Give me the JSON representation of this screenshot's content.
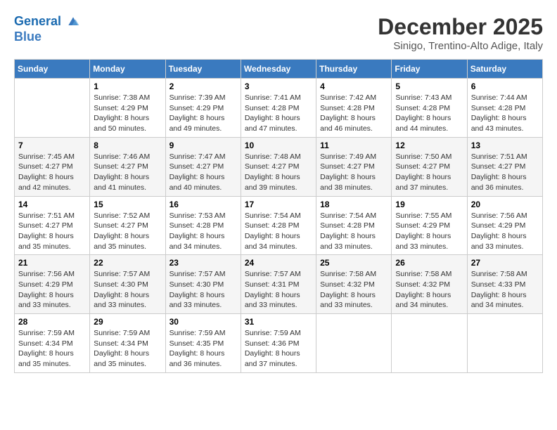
{
  "header": {
    "logo_line1": "General",
    "logo_line2": "Blue",
    "title": "December 2025",
    "subtitle": "Sinigo, Trentino-Alto Adige, Italy"
  },
  "days_of_week": [
    "Sunday",
    "Monday",
    "Tuesday",
    "Wednesday",
    "Thursday",
    "Friday",
    "Saturday"
  ],
  "weeks": [
    [
      {
        "day": "",
        "info": ""
      },
      {
        "day": "1",
        "info": "Sunrise: 7:38 AM\nSunset: 4:29 PM\nDaylight: 8 hours\nand 50 minutes."
      },
      {
        "day": "2",
        "info": "Sunrise: 7:39 AM\nSunset: 4:29 PM\nDaylight: 8 hours\nand 49 minutes."
      },
      {
        "day": "3",
        "info": "Sunrise: 7:41 AM\nSunset: 4:28 PM\nDaylight: 8 hours\nand 47 minutes."
      },
      {
        "day": "4",
        "info": "Sunrise: 7:42 AM\nSunset: 4:28 PM\nDaylight: 8 hours\nand 46 minutes."
      },
      {
        "day": "5",
        "info": "Sunrise: 7:43 AM\nSunset: 4:28 PM\nDaylight: 8 hours\nand 44 minutes."
      },
      {
        "day": "6",
        "info": "Sunrise: 7:44 AM\nSunset: 4:28 PM\nDaylight: 8 hours\nand 43 minutes."
      }
    ],
    [
      {
        "day": "7",
        "info": "Sunrise: 7:45 AM\nSunset: 4:27 PM\nDaylight: 8 hours\nand 42 minutes."
      },
      {
        "day": "8",
        "info": "Sunrise: 7:46 AM\nSunset: 4:27 PM\nDaylight: 8 hours\nand 41 minutes."
      },
      {
        "day": "9",
        "info": "Sunrise: 7:47 AM\nSunset: 4:27 PM\nDaylight: 8 hours\nand 40 minutes."
      },
      {
        "day": "10",
        "info": "Sunrise: 7:48 AM\nSunset: 4:27 PM\nDaylight: 8 hours\nand 39 minutes."
      },
      {
        "day": "11",
        "info": "Sunrise: 7:49 AM\nSunset: 4:27 PM\nDaylight: 8 hours\nand 38 minutes."
      },
      {
        "day": "12",
        "info": "Sunrise: 7:50 AM\nSunset: 4:27 PM\nDaylight: 8 hours\nand 37 minutes."
      },
      {
        "day": "13",
        "info": "Sunrise: 7:51 AM\nSunset: 4:27 PM\nDaylight: 8 hours\nand 36 minutes."
      }
    ],
    [
      {
        "day": "14",
        "info": "Sunrise: 7:51 AM\nSunset: 4:27 PM\nDaylight: 8 hours\nand 35 minutes."
      },
      {
        "day": "15",
        "info": "Sunrise: 7:52 AM\nSunset: 4:27 PM\nDaylight: 8 hours\nand 35 minutes."
      },
      {
        "day": "16",
        "info": "Sunrise: 7:53 AM\nSunset: 4:28 PM\nDaylight: 8 hours\nand 34 minutes."
      },
      {
        "day": "17",
        "info": "Sunrise: 7:54 AM\nSunset: 4:28 PM\nDaylight: 8 hours\nand 34 minutes."
      },
      {
        "day": "18",
        "info": "Sunrise: 7:54 AM\nSunset: 4:28 PM\nDaylight: 8 hours\nand 33 minutes."
      },
      {
        "day": "19",
        "info": "Sunrise: 7:55 AM\nSunset: 4:29 PM\nDaylight: 8 hours\nand 33 minutes."
      },
      {
        "day": "20",
        "info": "Sunrise: 7:56 AM\nSunset: 4:29 PM\nDaylight: 8 hours\nand 33 minutes."
      }
    ],
    [
      {
        "day": "21",
        "info": "Sunrise: 7:56 AM\nSunset: 4:29 PM\nDaylight: 8 hours\nand 33 minutes."
      },
      {
        "day": "22",
        "info": "Sunrise: 7:57 AM\nSunset: 4:30 PM\nDaylight: 8 hours\nand 33 minutes."
      },
      {
        "day": "23",
        "info": "Sunrise: 7:57 AM\nSunset: 4:30 PM\nDaylight: 8 hours\nand 33 minutes."
      },
      {
        "day": "24",
        "info": "Sunrise: 7:57 AM\nSunset: 4:31 PM\nDaylight: 8 hours\nand 33 minutes."
      },
      {
        "day": "25",
        "info": "Sunrise: 7:58 AM\nSunset: 4:32 PM\nDaylight: 8 hours\nand 33 minutes."
      },
      {
        "day": "26",
        "info": "Sunrise: 7:58 AM\nSunset: 4:32 PM\nDaylight: 8 hours\nand 34 minutes."
      },
      {
        "day": "27",
        "info": "Sunrise: 7:58 AM\nSunset: 4:33 PM\nDaylight: 8 hours\nand 34 minutes."
      }
    ],
    [
      {
        "day": "28",
        "info": "Sunrise: 7:59 AM\nSunset: 4:34 PM\nDaylight: 8 hours\nand 35 minutes."
      },
      {
        "day": "29",
        "info": "Sunrise: 7:59 AM\nSunset: 4:34 PM\nDaylight: 8 hours\nand 35 minutes."
      },
      {
        "day": "30",
        "info": "Sunrise: 7:59 AM\nSunset: 4:35 PM\nDaylight: 8 hours\nand 36 minutes."
      },
      {
        "day": "31",
        "info": "Sunrise: 7:59 AM\nSunset: 4:36 PM\nDaylight: 8 hours\nand 37 minutes."
      },
      {
        "day": "",
        "info": ""
      },
      {
        "day": "",
        "info": ""
      },
      {
        "day": "",
        "info": ""
      }
    ]
  ]
}
